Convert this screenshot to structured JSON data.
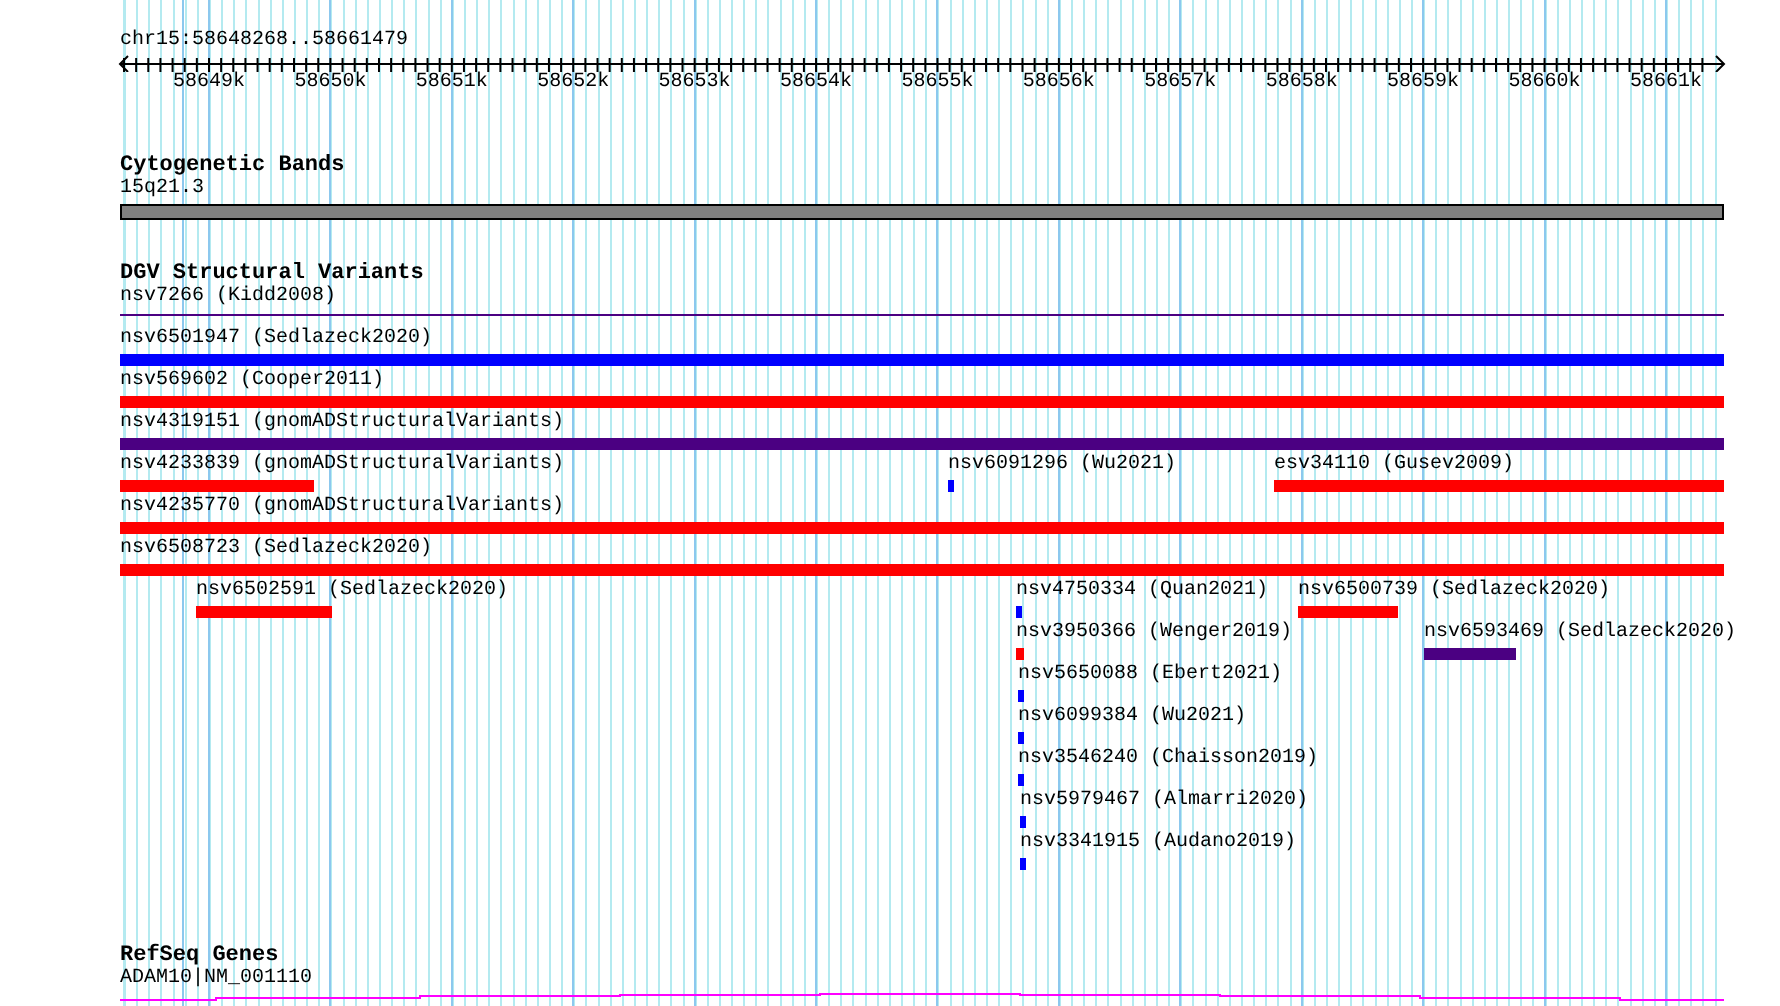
{
  "ruler": {
    "location": "chr15:58648268..58661479",
    "tick_labels": [
      "58649k",
      "58650k",
      "58651k",
      "58652k",
      "58653k",
      "58654k",
      "58655k",
      "58656k",
      "58657k",
      "58658k",
      "58659k",
      "58660k",
      "58661k"
    ]
  },
  "tracks": [
    {
      "kind": "cytoband",
      "title": "Cytogenetic Bands",
      "band": "15q21.3"
    },
    {
      "kind": "variants",
      "title": "DGV Structural Variants",
      "rows": [
        {
          "features": [
            {
              "label": "nsv7266 (Kidd2008)",
              "color": "#4b0082"
            }
          ]
        },
        {
          "features": [
            {
              "label": "nsv6501947 (Sedlazeck2020)",
              "color": "#0000ff"
            }
          ]
        },
        {
          "features": [
            {
              "label": "nsv569602 (Cooper2011)",
              "color": "#ff0000"
            }
          ]
        },
        {
          "features": [
            {
              "label": "nsv4319151 (gnomADStructuralVariants)",
              "color": "#4b0082"
            }
          ]
        },
        {
          "features": [
            {
              "label": "nsv4233839 (gnomADStructuralVariants)",
              "color": "#ff0000"
            },
            {
              "label": "nsv6091296 (Wu2021)",
              "color": "#0000ff"
            },
            {
              "label": "esv34110 (Gusev2009)",
              "color": "#ff0000"
            }
          ]
        },
        {
          "features": [
            {
              "label": "nsv4235770 (gnomADStructuralVariants)",
              "color": "#ff0000"
            }
          ]
        },
        {
          "features": [
            {
              "label": "nsv6508723 (Sedlazeck2020)",
              "color": "#ff0000"
            }
          ]
        },
        {
          "features": [
            {
              "label": "nsv6502591 (Sedlazeck2020)",
              "color": "#ff0000"
            },
            {
              "label": "nsv4750334 (Quan2021)",
              "color": "#0000ff"
            },
            {
              "label": "nsv6500739 (Sedlazeck2020)",
              "color": "#ff0000"
            }
          ]
        },
        {
          "features": [
            {
              "label": "nsv3950366 (Wenger2019)",
              "color": "#ff0000"
            },
            {
              "label": "nsv6593469 (Sedlazeck2020)",
              "color": "#4b0082"
            }
          ]
        },
        {
          "features": [
            {
              "label": "nsv5650088 (Ebert2021)",
              "color": "#0000ff"
            }
          ]
        },
        {
          "features": [
            {
              "label": "nsv6099384 (Wu2021)",
              "color": "#0000ff"
            }
          ]
        },
        {
          "features": [
            {
              "label": "nsv3546240 (Chaisson2019)",
              "color": "#0000ff"
            }
          ]
        },
        {
          "features": [
            {
              "label": "nsv5979467 (Almarri2020)",
              "color": "#0000ff"
            }
          ]
        },
        {
          "features": [
            {
              "label": "nsv3341915 (Audano2019)",
              "color": "#0000ff"
            }
          ]
        }
      ]
    },
    {
      "kind": "genes",
      "title": "RefSeq Genes",
      "gene": "ADAM10|NM_001110"
    }
  ]
}
